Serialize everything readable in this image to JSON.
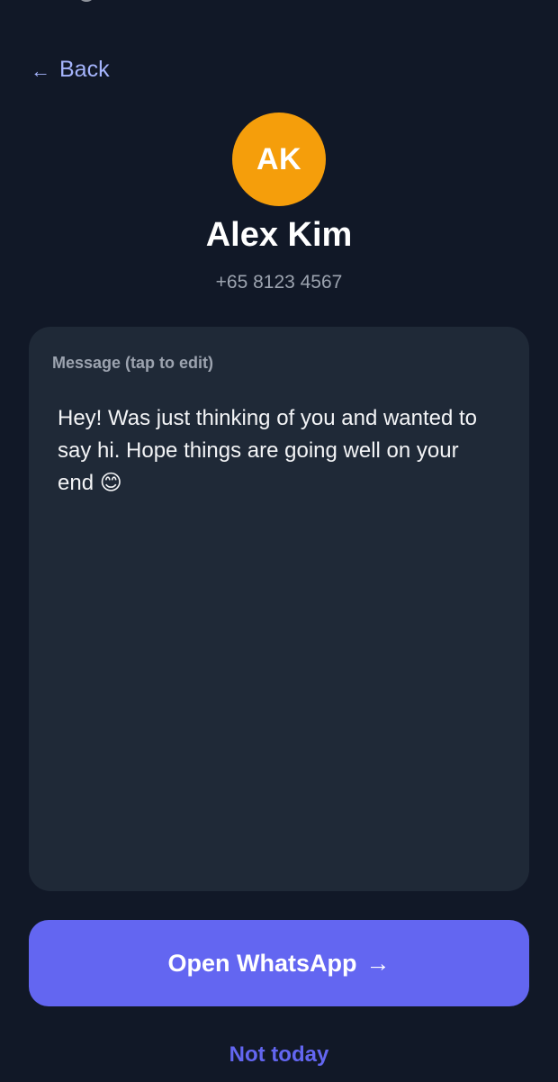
{
  "nav": {
    "back_arrow": "←",
    "back_label": "Back"
  },
  "contact": {
    "initials": "AK",
    "name": "Alex Kim",
    "phone": "+65 8123 4567",
    "avatar_color": "#f59e0b"
  },
  "message": {
    "label": "Message (tap to edit)",
    "text": "Hey! Was just thinking of you and wanted to say hi. Hope things are going well on your end 😊"
  },
  "actions": {
    "primary_label": "Open WhatsApp",
    "primary_arrow": "→",
    "primary_color": "#6366f1",
    "secondary_label": "Not today"
  },
  "theme": {
    "background": "#111827",
    "card": "#1f2937",
    "accent_light": "#a5b4fc"
  }
}
